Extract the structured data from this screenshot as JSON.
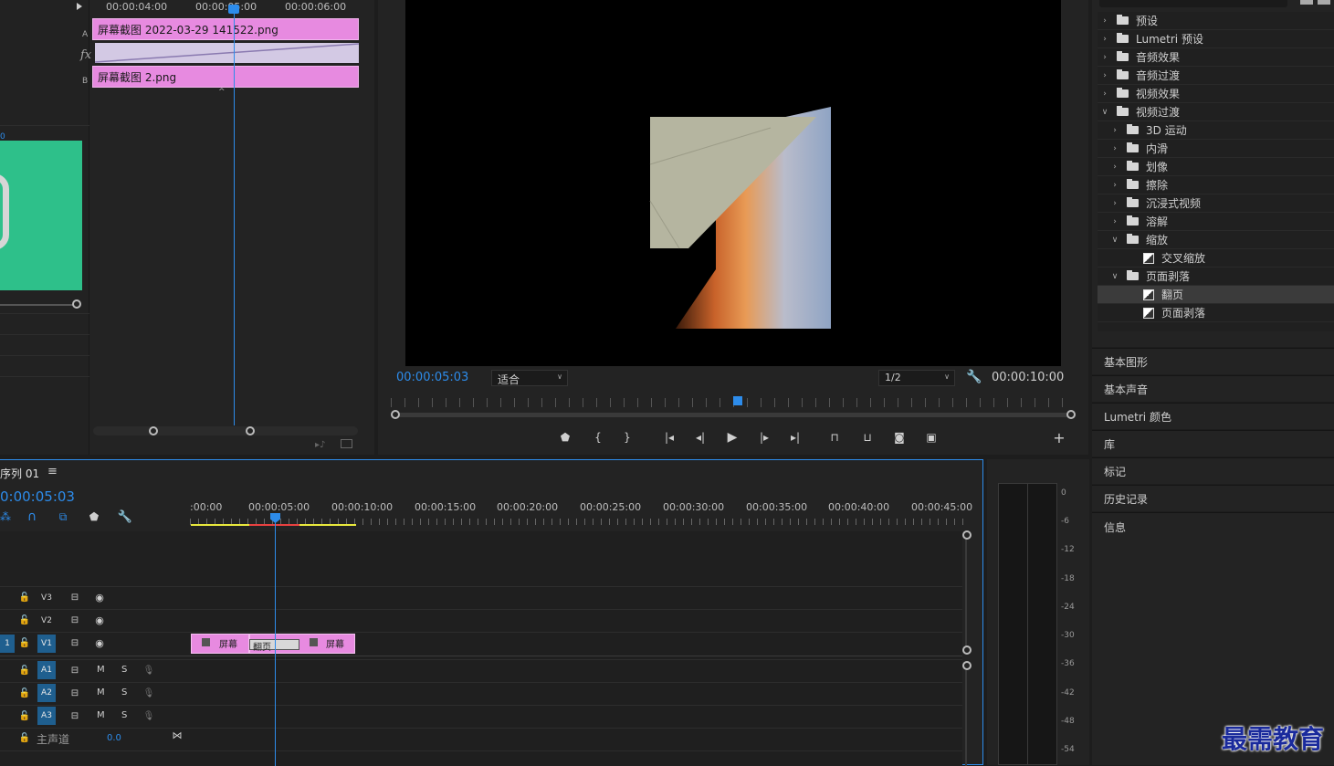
{
  "effect_controls": {
    "ruler_ticks": [
      "00:00:04:00",
      "00:00:05:00",
      "00:00:06:00"
    ],
    "clip_a": "屏幕截图 2022-03-29  141522.png",
    "clip_b": "屏幕截图 2.png",
    "label_a": "A",
    "label_b": "B",
    "fx_label": "fx"
  },
  "program_monitor": {
    "timecode_current": "00:00:05:03",
    "fit_select": "适合",
    "quality_select": "1/2",
    "timecode_duration": "00:00:10:00"
  },
  "effects_panel": {
    "items": [
      {
        "label": "预设",
        "type": "preset",
        "indent": 0,
        "expanded": false
      },
      {
        "label": "Lumetri 预设",
        "type": "preset",
        "indent": 0,
        "expanded": false
      },
      {
        "label": "音频效果",
        "type": "folder",
        "indent": 0,
        "expanded": false
      },
      {
        "label": "音频过渡",
        "type": "folder",
        "indent": 0,
        "expanded": false
      },
      {
        "label": "视频效果",
        "type": "folder",
        "indent": 0,
        "expanded": false
      },
      {
        "label": "视频过渡",
        "type": "folder",
        "indent": 0,
        "expanded": true
      },
      {
        "label": "3D 运动",
        "type": "folder",
        "indent": 1,
        "expanded": false
      },
      {
        "label": "内滑",
        "type": "folder",
        "indent": 1,
        "expanded": false
      },
      {
        "label": "划像",
        "type": "folder",
        "indent": 1,
        "expanded": false
      },
      {
        "label": "擦除",
        "type": "folder",
        "indent": 1,
        "expanded": false
      },
      {
        "label": "沉浸式视频",
        "type": "folder",
        "indent": 1,
        "expanded": false
      },
      {
        "label": "溶解",
        "type": "folder",
        "indent": 1,
        "expanded": false
      },
      {
        "label": "缩放",
        "type": "folder",
        "indent": 1,
        "expanded": true
      },
      {
        "label": "交叉缩放",
        "type": "effect",
        "indent": 2
      },
      {
        "label": "页面剥落",
        "type": "folder",
        "indent": 1,
        "expanded": true
      },
      {
        "label": "翻页",
        "type": "effect",
        "indent": 2,
        "selected": true
      },
      {
        "label": "页面剥落",
        "type": "effect",
        "indent": 2
      }
    ]
  },
  "side_panels": [
    "基本图形",
    "基本声音",
    "Lumetri 颜色",
    "库",
    "标记",
    "历史记录",
    "信息"
  ],
  "timeline": {
    "sequence_name": "序列 01",
    "timecode": "0:00:05:03",
    "ruler_ticks": [
      ":00:00",
      "00:00:05:00",
      "00:00:10:00",
      "00:00:15:00",
      "00:00:20:00",
      "00:00:25:00",
      "00:00:30:00",
      "00:00:35:00",
      "00:00:40:00",
      "00:00:45:00"
    ],
    "video_tracks": [
      "V3",
      "V2",
      "V1"
    ],
    "audio_tracks": [
      "A1",
      "A2",
      "A3"
    ],
    "mute_label": "M",
    "solo_label": "S",
    "master_label": "主声道",
    "master_value": "0.0",
    "v1_source": "1",
    "clip1_label": "屏幕",
    "clip2_label": "屏幕",
    "transition_label": "翻页"
  },
  "audio_meter": {
    "ticks": [
      "0",
      "-6",
      "-12",
      "-18",
      "-24",
      "-30",
      "-36",
      "-42",
      "-48",
      "-54"
    ]
  },
  "watermark": "最需教育",
  "colors": {
    "accent_blue": "#2d8ceb",
    "clip_pink": "#e78ae0",
    "track_button_blue": "#1f5f8f"
  }
}
